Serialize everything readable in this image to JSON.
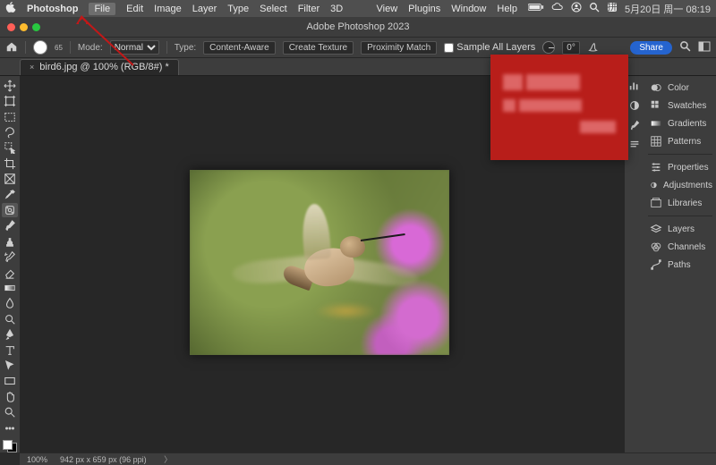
{
  "menubar": {
    "app": "Photoshop",
    "items": [
      "File",
      "Edit",
      "Image",
      "Layer",
      "Type",
      "Select",
      "Filter",
      "3D"
    ],
    "right_items": [
      "View",
      "Plugins",
      "Window",
      "Help"
    ],
    "clock": "5月20日 周一  08:19"
  },
  "window": {
    "title": "Adobe Photoshop 2023",
    "traffic_colors": [
      "#ff5f57",
      "#febc2e",
      "#28c840"
    ]
  },
  "options": {
    "brush_size": "65",
    "mode_label": "Mode:",
    "mode_value": "Normal",
    "type_label": "Type:",
    "type_buttons": [
      "Content-Aware",
      "Create Texture",
      "Proximity Match"
    ],
    "sample_all_label": "Sample All Layers",
    "sample_all_checked": false,
    "angle_icon": "angle-icon",
    "angle_value": "0°",
    "share_label": "Share"
  },
  "tab": {
    "label": "bird6.jpg @ 100% (RGB/8#) *"
  },
  "tools": [
    "move-tool",
    "artboard-tool",
    "rect-marquee-tool",
    "lasso-tool",
    "object-select-tool",
    "crop-tool",
    "frame-tool",
    "eyedropper-tool",
    "spot-heal-tool",
    "brush-tool",
    "clone-stamp-tool",
    "history-brush-tool",
    "eraser-tool",
    "gradient-tool",
    "blur-tool",
    "dodge-tool",
    "pen-tool",
    "type-tool",
    "path-select-tool",
    "rectangle-tool",
    "hand-tool",
    "zoom-tool",
    "edit-toolbar"
  ],
  "active_tool_index": 8,
  "mid_icons": [
    "histogram-icon",
    "adjust-icon",
    "brush-preset-icon",
    "paragraph-icon"
  ],
  "panels": {
    "groups": [
      [
        "Color",
        "Swatches",
        "Gradients",
        "Patterns"
      ],
      [
        "Properties",
        "Adjustments",
        "Libraries"
      ],
      [
        "Layers",
        "Channels",
        "Paths"
      ]
    ],
    "icons": {
      "Color": "color-icon",
      "Swatches": "swatches-icon",
      "Gradients": "gradients-icon",
      "Patterns": "patterns-icon",
      "Properties": "properties-icon",
      "Adjustments": "adjustments-icon",
      "Libraries": "libraries-icon",
      "Layers": "layers-icon",
      "Channels": "channels-icon",
      "Paths": "paths-icon"
    }
  },
  "status": {
    "zoom": "100%",
    "dims": "942 px x 659 px (96 ppi)"
  }
}
